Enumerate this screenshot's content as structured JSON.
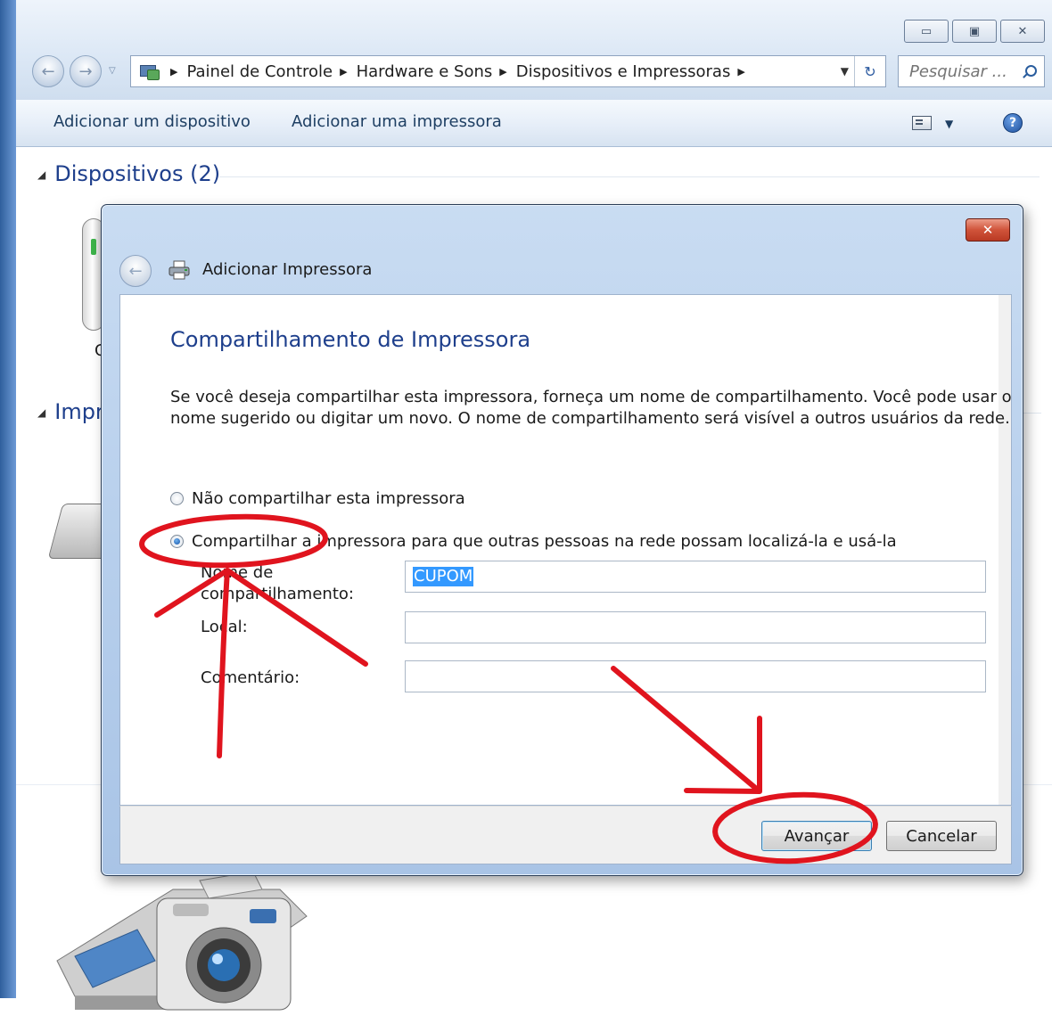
{
  "explorer": {
    "breadcrumb": [
      "Painel de Controle",
      "Hardware e Sons",
      "Dispositivos e Impressoras"
    ],
    "search_placeholder": "Pesquisar ...",
    "command_bar": {
      "add_device": "Adicionar um dispositivo",
      "add_printer": "Adicionar uma impressora"
    },
    "groups": {
      "devices": "Dispositivos (2)",
      "printers_partial": "Impr"
    },
    "partial_device_label": "C"
  },
  "dialog": {
    "title": "Adicionar Impressora",
    "heading": "Compartilhamento de Impressora",
    "description_line1": "Se você deseja compartilhar esta impressora, forneça um nome de compartilhamento. Você pode usar o",
    "description_line2": "nome sugerido ou digitar um novo. O nome de compartilhamento será visível a outros usuários da rede.",
    "options": {
      "no_share": "Não compartilhar esta impressora",
      "share": "Compartilhar a impressora para que outras pessoas na rede possam localizá-la e usá-la"
    },
    "selected_option": "share",
    "fields": {
      "share_name_label_line1": "Nome de",
      "share_name_label_line2": "compartilhamento:",
      "share_name_value": "CUPOM",
      "location_label": "Local:",
      "location_value": "",
      "comment_label": "Comentário:",
      "comment_value": ""
    },
    "buttons": {
      "next": "Avançar",
      "cancel": "Cancelar"
    }
  },
  "colors": {
    "heading_blue": "#1e3f8c",
    "annotation_red": "#e0141e",
    "selection_blue": "#3399ff"
  }
}
